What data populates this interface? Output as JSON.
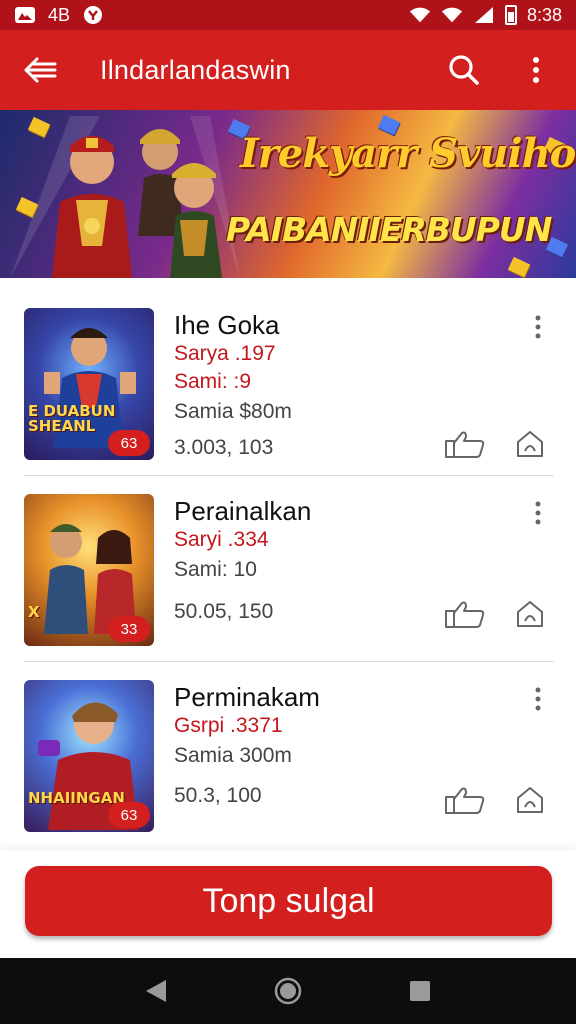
{
  "status_bar": {
    "network": "4B",
    "time": "8:38"
  },
  "app_bar": {
    "title": "Ilndarlandaswin",
    "back_icon": "back-arrow-icon",
    "search_icon": "search-icon",
    "menu_icon": "more-vert-icon",
    "color": "#d3201f"
  },
  "banner": {
    "title": "Irekyarr Svuiho",
    "subtitle": "PAIBANIIERBUPUN"
  },
  "items": [
    {
      "title": "Ihe Goka",
      "red_line1": "Sarya .197",
      "red_line2": "Sami: :9",
      "gray_line": "Samia $80m",
      "count": "3.003, 103",
      "thumb_caption": "E DUABUN SHEANL",
      "badge": "63"
    },
    {
      "title": "Perainalkan",
      "red_line1": "Saryi .334",
      "red_line2": "",
      "gray_line": "Sami: 10",
      "count": "50.05, 150",
      "thumb_caption": "X",
      "badge": "33"
    },
    {
      "title": "Perminakam",
      "red_line1": "Gsrpi .3371",
      "red_line2": "",
      "gray_line": "Samia 300m",
      "count": "50.3, 100",
      "thumb_caption": "NHAIINGAN",
      "badge": "63"
    }
  ],
  "cta": {
    "label": "Tonp sulgal"
  },
  "colors": {
    "accent": "#d3201f",
    "status_bar": "#b0121a",
    "red_text": "#c4161c"
  }
}
